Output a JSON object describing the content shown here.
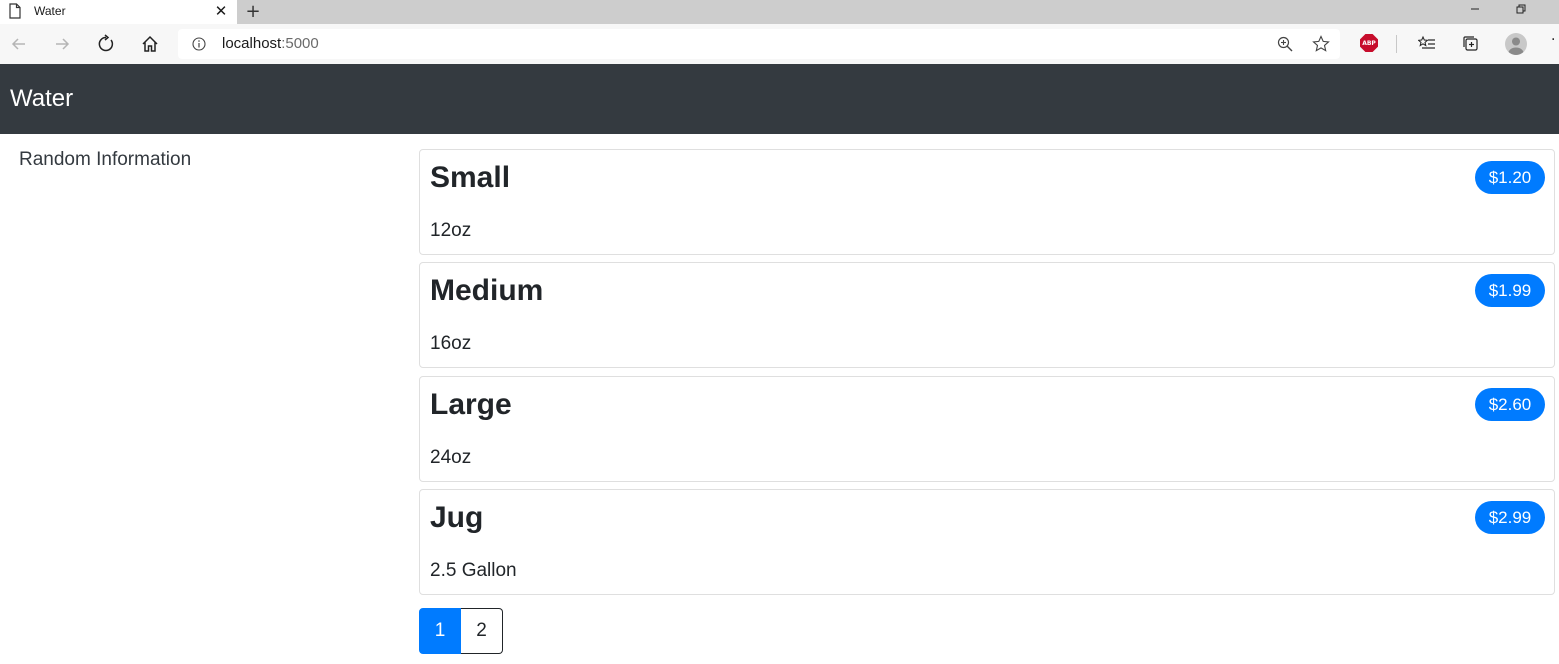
{
  "browser": {
    "tab_title": "Water",
    "tab_close": "✕",
    "new_tab": "+",
    "url_host": "localhost",
    "url_port": ":5000"
  },
  "navbar": {
    "brand": "Water"
  },
  "sidebar": {
    "text": "Random Information"
  },
  "products": [
    {
      "name": "Small",
      "size": "12oz",
      "price": "$1.20"
    },
    {
      "name": "Medium",
      "size": "16oz",
      "price": "$1.99"
    },
    {
      "name": "Large",
      "size": "24oz",
      "price": "$2.60"
    },
    {
      "name": "Jug",
      "size": "2.5 Gallon",
      "price": "$2.99"
    }
  ],
  "pagination": {
    "pages": [
      "1",
      "2"
    ],
    "active": "1"
  },
  "colors": {
    "navbar": "#343a40",
    "accent": "#007bff"
  }
}
